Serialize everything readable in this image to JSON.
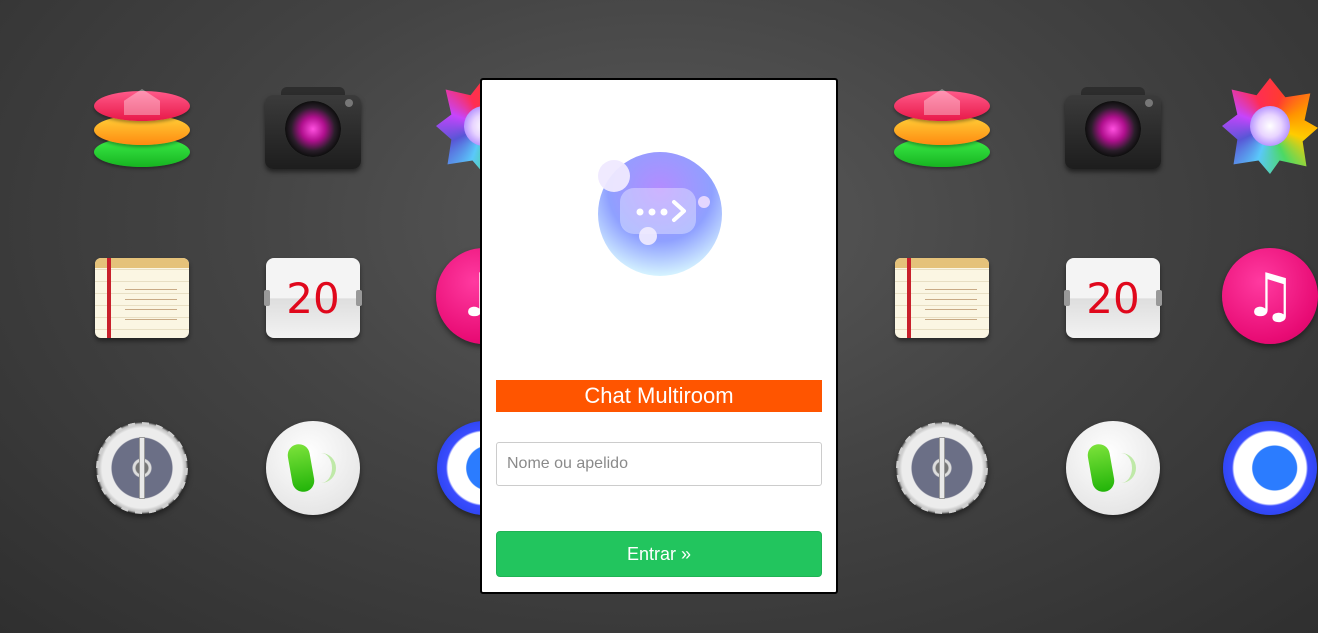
{
  "background": {
    "icons": [
      {
        "name": "layers-app-icon",
        "kind": "layers"
      },
      {
        "name": "camera-app-icon",
        "kind": "camera"
      },
      {
        "name": "photos-app-icon",
        "kind": "flower"
      },
      {
        "name": "notes-app-icon",
        "kind": "notes"
      },
      {
        "name": "calendar-app-icon",
        "kind": "calendar",
        "label": "20"
      },
      {
        "name": "music-app-icon",
        "kind": "music",
        "glyph": "♫"
      },
      {
        "name": "settings-app-icon",
        "kind": "gear"
      },
      {
        "name": "phone-app-icon",
        "kind": "phone"
      },
      {
        "name": "browser-app-icon",
        "kind": "bluering"
      }
    ]
  },
  "login": {
    "title": "Chat Multiroom",
    "name_placeholder": "Nome ou apelido",
    "name_value": "",
    "submit_label": "Entrar »"
  },
  "colors": {
    "title_bg": "#ff5500",
    "button_bg": "#22c55e"
  }
}
